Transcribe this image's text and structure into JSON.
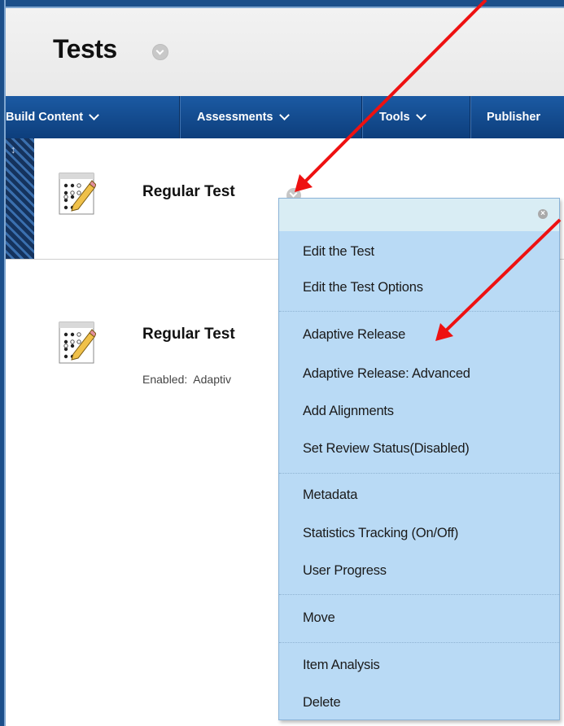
{
  "page": {
    "title": "Tests"
  },
  "actionbar": {
    "build_content": "Build Content",
    "assessments": "Assessments",
    "tools": "Tools",
    "publisher": "Publisher"
  },
  "items": [
    {
      "title": "Regular Test",
      "icon": "test-pencil-icon"
    },
    {
      "title": "Regular Test",
      "icon": "test-pencil-icon",
      "enabled_label": "Enabled:",
      "enabled_value": "Adaptiv"
    }
  ],
  "context_menu": {
    "close_icon": "close-icon",
    "groups": [
      [
        "Edit the Test",
        "Edit the Test Options"
      ],
      [
        "Adaptive Release",
        "Adaptive Release: Advanced",
        "Add Alignments",
        "Set Review Status(Disabled)"
      ],
      [
        "Metadata",
        "Statistics Tracking (On/Off)",
        "User Progress"
      ],
      [
        "Move"
      ],
      [
        "Item Analysis",
        "Delete"
      ]
    ]
  },
  "annotation": {
    "arrow_color": "#ee1111",
    "frame_color": "#1c4f8a",
    "menu_bg": "#b9daf5"
  }
}
